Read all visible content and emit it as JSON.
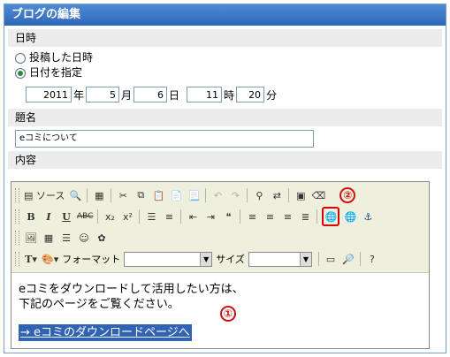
{
  "window": {
    "title": "ブログの編集"
  },
  "datetime": {
    "section_label": "日時",
    "option_posted": "投稿した日時",
    "option_specify": "日付を指定",
    "year": "2011",
    "year_unit": "年",
    "month": "5",
    "month_unit": "月",
    "day": "6",
    "day_unit": "日",
    "hour": "11",
    "hour_unit": "時",
    "minute": "20",
    "minute_unit": "分"
  },
  "subject": {
    "label": "題名",
    "value": "eコミについて"
  },
  "content": {
    "label": "内容",
    "toolbar": {
      "source_label": "ソース",
      "format_label": "フォーマット",
      "size_label": "サイズ",
      "marker_1": "①",
      "marker_2": "②"
    },
    "body_line1": "eコミをダウンロードして活用したい方は、",
    "body_line2": "下記のページをご覧ください。",
    "link_text": "→ eコミのダウンロードページへ"
  }
}
